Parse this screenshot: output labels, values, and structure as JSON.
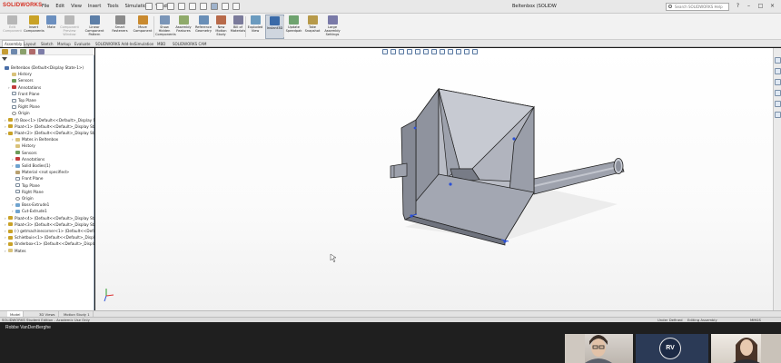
{
  "app": {
    "logo_text": "SOLIDWORKS",
    "window_title": "Beltenbox (SOLIDW"
  },
  "menu": [
    "File",
    "Edit",
    "View",
    "Insert",
    "Tools",
    "Simulation",
    "Window"
  ],
  "search": {
    "placeholder": "Search SOLIDWORKS Help"
  },
  "ribbon": [
    {
      "label": "Edit\nComponent",
      "icon": "edit-component-icon",
      "dim": true
    },
    {
      "label": "Insert\nComponents",
      "icon": "insert-components-icon"
    },
    {
      "label": "Mate",
      "icon": "mate-icon"
    },
    {
      "label": "Component\nPreview\nWindow",
      "icon": "preview-window-icon",
      "dim": true
    },
    {
      "label": "Linear Component\nPattern",
      "icon": "linear-pattern-icon"
    },
    {
      "label": "Smart\nFasteners",
      "icon": "smart-fasteners-icon"
    },
    {
      "label": "Move\nComponent",
      "icon": "move-component-icon"
    },
    {
      "label": "Show\nHidden\nComponents",
      "icon": "show-hidden-icon"
    },
    {
      "label": "Assembly\nFeatures",
      "icon": "assembly-features-icon"
    },
    {
      "label": "Reference\nGeometry",
      "icon": "reference-geometry-icon"
    },
    {
      "label": "New\nMotion\nStudy",
      "icon": "motion-study-icon"
    },
    {
      "label": "Bill of\nMaterials",
      "icon": "bom-icon"
    },
    {
      "label": "Exploded\nView",
      "icon": "exploded-view-icon"
    },
    {
      "label": "Instant3D",
      "icon": "instant3d-icon",
      "active": true
    },
    {
      "label": "Update\nSpeedpak",
      "icon": "speedpak-icon"
    },
    {
      "label": "Take\nSnapshot",
      "icon": "snapshot-icon"
    },
    {
      "label": "Large\nAssembly\nSettings",
      "icon": "large-assembly-icon"
    }
  ],
  "tabs": [
    "Assembly",
    "Layout",
    "Sketch",
    "Markup",
    "Evaluate",
    "SOLIDWORKS Add-Ins",
    "Simulation",
    "MBD",
    "SOLIDWORKS CAM"
  ],
  "tree": [
    {
      "label": "Beltenbox  (Default<Display State-1>)",
      "indent": 0,
      "icon": "ic-asm",
      "exp": ""
    },
    {
      "label": "History",
      "indent": 2,
      "icon": "ic-fold",
      "exp": ""
    },
    {
      "label": "Sensors",
      "indent": 2,
      "icon": "ic-sens",
      "exp": ""
    },
    {
      "label": "Annotations",
      "indent": 2,
      "icon": "ic-ann",
      "exp": "›"
    },
    {
      "label": "Front Plane",
      "indent": 2,
      "icon": "ic-plane",
      "exp": ""
    },
    {
      "label": "Top Plane",
      "indent": 2,
      "icon": "ic-plane",
      "exp": ""
    },
    {
      "label": "Right Plane",
      "indent": 2,
      "icon": "ic-plane",
      "exp": ""
    },
    {
      "label": "Origin",
      "indent": 2,
      "icon": "ic-orig",
      "exp": ""
    },
    {
      "label": "(f) Box<1> (Default<<Default>_Display State",
      "indent": 1,
      "icon": "ic-part",
      "exp": "›"
    },
    {
      "label": "Plaat<1> (Default<<Default>_Display State",
      "indent": 1,
      "icon": "ic-part",
      "exp": "›"
    },
    {
      "label": "Plaat<2> (Default<<Default>_Display State",
      "indent": 1,
      "icon": "ic-part",
      "exp": "⌄"
    },
    {
      "label": "Mates in Beltenbox",
      "indent": 3,
      "icon": "ic-fold",
      "exp": "›"
    },
    {
      "label": "History",
      "indent": 3,
      "icon": "ic-fold",
      "exp": ""
    },
    {
      "label": "Sensors",
      "indent": 3,
      "icon": "ic-sens",
      "exp": ""
    },
    {
      "label": "Annotations",
      "indent": 3,
      "icon": "ic-ann",
      "exp": "›"
    },
    {
      "label": "Solid Bodies(1)",
      "indent": 3,
      "icon": "ic-feat",
      "exp": "›"
    },
    {
      "label": "Material <not specified>",
      "indent": 3,
      "icon": "ic-mat",
      "exp": ""
    },
    {
      "label": "Front Plane",
      "indent": 3,
      "icon": "ic-plane",
      "exp": ""
    },
    {
      "label": "Top Plane",
      "indent": 3,
      "icon": "ic-plane",
      "exp": ""
    },
    {
      "label": "Right Plane",
      "indent": 3,
      "icon": "ic-plane",
      "exp": ""
    },
    {
      "label": "Origin",
      "indent": 3,
      "icon": "ic-orig",
      "exp": ""
    },
    {
      "label": "Boss-Extrude1",
      "indent": 3,
      "icon": "ic-feat",
      "exp": "›"
    },
    {
      "label": "Cut-Extrude1",
      "indent": 3,
      "icon": "ic-feat",
      "exp": "›"
    },
    {
      "label": "Plaat<4> (Default<<Default>_Display State",
      "indent": 1,
      "icon": "ic-part",
      "exp": "›"
    },
    {
      "label": "Plaat<3> (Default<<Default>_Display State",
      "indent": 1,
      "icon": "ic-part",
      "exp": "›"
    },
    {
      "label": "(-) getmachinecorner<1> (Default<<Default>",
      "indent": 1,
      "icon": "ic-part",
      "exp": "›"
    },
    {
      "label": "Schietbuis<1> (Default<<Default>_Display",
      "indent": 1,
      "icon": "ic-part",
      "exp": "›"
    },
    {
      "label": "Onderbox<1> (Default<<Default>_Display",
      "indent": 1,
      "icon": "ic-part",
      "exp": "›"
    },
    {
      "label": "Mates",
      "indent": 1,
      "icon": "ic-fold",
      "exp": "›"
    }
  ],
  "model_tabs": [
    "Model",
    "3D Views",
    "Motion Study 1"
  ],
  "status": {
    "left": "SOLIDWORKS Student Edition - Academic Use Only",
    "defined": "Under Defined",
    "editing": "Editing Assembly",
    "units": "MMGS"
  },
  "call": {
    "presenter": "Robbe VanDenBerghe",
    "avatar_initials": "RV"
  },
  "colors": {
    "model_face": "#a7abb6",
    "model_light": "#c6c9d2",
    "model_dark": "#7e828e",
    "edge": "#1e1e22",
    "point": "#2a4fd6"
  }
}
